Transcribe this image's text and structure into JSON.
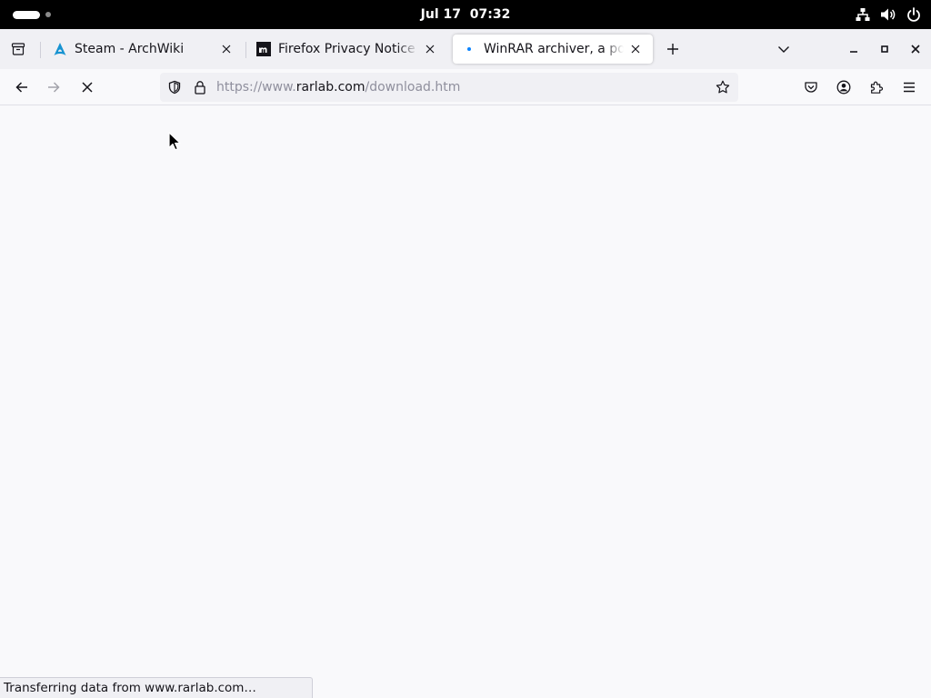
{
  "system_bar": {
    "date": "Jul 17",
    "time": "07:32"
  },
  "tabs": [
    {
      "label": "Steam - ArchWiki",
      "favicon": "archwiki-icon",
      "active": false
    },
    {
      "label": "Firefox Privacy Notice — Mozilla",
      "favicon": "mozilla-icon",
      "active": false
    },
    {
      "label": "WinRAR archiver, a powerful tool",
      "favicon": "loading-dot-icon",
      "active": true
    }
  ],
  "address_bar": {
    "scheme": "https://www.",
    "host": "rarlab.com",
    "path": "/download.htm"
  },
  "status_text": "Transferring data from www.rarlab.com…",
  "colors": {
    "accent": "#0060df",
    "archwiki_blue": "#1793d1",
    "loading_dot": "#0a84ff"
  }
}
